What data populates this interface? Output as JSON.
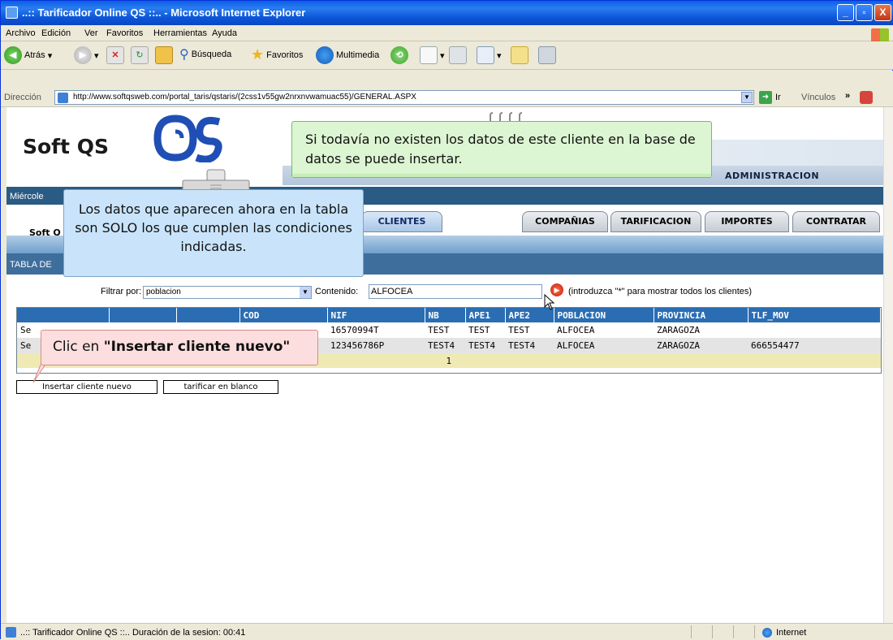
{
  "window": {
    "title": "..:: Tarificador Online QS ::.. - Microsoft Internet Explorer",
    "controls": [
      "_",
      "▫",
      "X"
    ]
  },
  "menu": {
    "items": [
      "Archivo",
      "Edición",
      "Ver",
      "Favoritos",
      "Herramientas",
      "Ayuda"
    ]
  },
  "toolbar": {
    "back": "Atrás",
    "search": "Búsqueda",
    "favorites": "Favoritos",
    "multimedia": "Multimedia"
  },
  "address": {
    "label": "Dirección",
    "url": "http://www.softqsweb.com/portal_taris/qstaris/(2css1v55gw2nrxnvwamuac55)/GENERAL.ASPX",
    "go": "Ir",
    "links": "Vínculos"
  },
  "header": {
    "logo_text": "Soft QS",
    "admin": "ADMINISTRACION",
    "date_prefix": "Miércole"
  },
  "tabs": {
    "softq": "Soft Q",
    "items": [
      "CLIENTES",
      "COMPAÑIAS",
      "TARIFICACION",
      "IMPORTES",
      "CONTRATAR"
    ]
  },
  "section_label": "TABLA DE",
  "filter": {
    "label": "Filtrar por:",
    "value": "poblacion",
    "content_label": "Contenido:",
    "content_value": "ALFOCEA",
    "hint": "(introduzca \"*\" para mostrar todos los clientes)"
  },
  "grid": {
    "headers": [
      "",
      "",
      "",
      "COD",
      "NIF",
      "NB",
      "APE1",
      "APE2",
      "POBLACION",
      "PROVINCIA",
      "TLF_MOV"
    ],
    "rows": [
      [
        "Se",
        "",
        "",
        "",
        "16570994T",
        "TEST",
        "TEST",
        "TEST",
        "ALFOCEA",
        "ZARAGOZA",
        ""
      ],
      [
        "Se",
        "",
        "",
        "",
        "123456786P",
        "TEST4",
        "TEST4",
        "TEST4",
        "ALFOCEA",
        "ZARAGOZA",
        "666554477"
      ]
    ],
    "page": "1"
  },
  "buttons": {
    "insert": "Insertar cliente nuevo",
    "blank": "tarificar en blanco"
  },
  "callouts": {
    "green": "Si todavía no existen los datos de este cliente en la base de datos se puede insertar.",
    "blue": "Los datos que aparecen ahora en la tabla son SOLO los que cumplen las condiciones indicadas.",
    "red_prefix": "Clic en ",
    "red_bold": "\"Insertar cliente nuevo\""
  },
  "status": {
    "text": "..:: Tarificador Online QS ::.. Duración de la sesion:  00:41",
    "zone": "Internet"
  },
  "colors": {
    "title_bar": "#0a5fe6",
    "page_blue": "#2a5b84",
    "grid_header": "#2b6db3",
    "callout_green": "#dcf5d2",
    "callout_blue": "#c9e4fa",
    "callout_red": "#fcdede"
  }
}
